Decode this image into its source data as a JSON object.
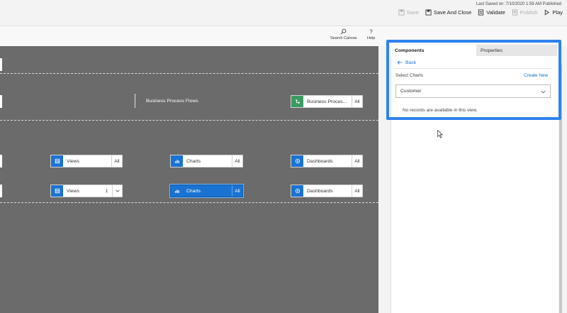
{
  "topbar": {
    "saved_status": "Last Saved on :7/10/2020 1:59 AM Published",
    "commands": {
      "save": "Save",
      "save_and_close": "Save And Close",
      "validate": "Validate",
      "publish": "Publish",
      "play": "Play"
    }
  },
  "subbar": {
    "search_label": "Search Canvas",
    "help_label": "Help"
  },
  "canvas": {
    "bpf_title": "Business Process Flows",
    "rows": [
      {
        "tiles": [
          {
            "label": "Business Proces...",
            "selector": "All",
            "icon": "process-flow-icon",
            "color": "#3a9b62"
          }
        ]
      },
      {
        "tiles": [
          {
            "label": "Views",
            "selector": "All",
            "icon": "grid-icon"
          },
          {
            "label": "Charts",
            "selector": "All",
            "icon": "chart-icon"
          },
          {
            "label": "Dashboards",
            "selector": "All",
            "icon": "dashboard-icon"
          }
        ]
      },
      {
        "tiles": [
          {
            "label": "Views",
            "selector": "1",
            "icon": "grid-icon"
          },
          {
            "label": "Charts",
            "selector": "All",
            "icon": "chart-icon",
            "active": true
          },
          {
            "label": "Dashboards",
            "selector": "All",
            "icon": "dashboard-icon"
          }
        ]
      }
    ]
  },
  "panel": {
    "tabs": {
      "components": "Components",
      "properties": "Properties"
    },
    "active_tab": "Components",
    "back": "Back",
    "select_label": "Select Charts",
    "create_new": "Create New",
    "dropdown_value": "Customer",
    "empty_message": "No records are available in this view."
  },
  "colors": {
    "accent": "#1a73d2",
    "highlight_border": "#2f82ee",
    "canvas_bg": "#6b6b6b",
    "process_green": "#3a9b62"
  }
}
